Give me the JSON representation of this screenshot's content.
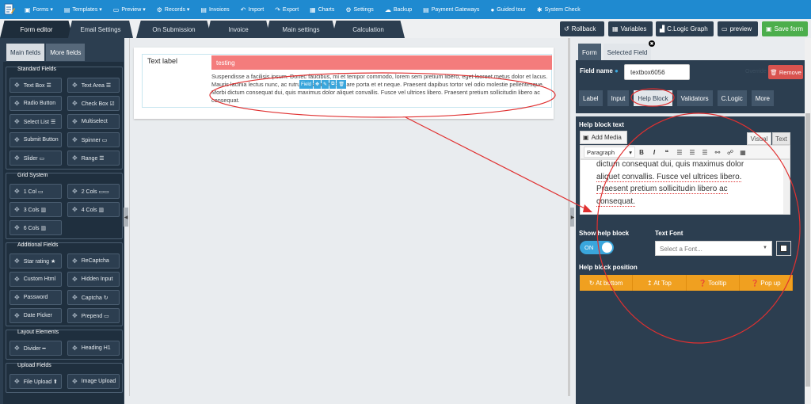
{
  "topnav": {
    "items": [
      {
        "icon": "▣",
        "label": "Forms ▾"
      },
      {
        "icon": "▤",
        "label": "Templates ▾"
      },
      {
        "icon": "▭",
        "label": "Preview ▾"
      },
      {
        "icon": "⚙",
        "label": "Records ▾"
      },
      {
        "icon": "▤",
        "label": "Invoices"
      },
      {
        "icon": "↶",
        "label": "Import"
      },
      {
        "icon": "↷",
        "label": "Export"
      },
      {
        "icon": "▦",
        "label": "Charts"
      },
      {
        "icon": "⚙",
        "label": "Settings"
      },
      {
        "icon": "☁",
        "label": "Backup"
      },
      {
        "icon": "▤",
        "label": "Payment Gateways"
      },
      {
        "icon": "●",
        "label": "Guided tour"
      },
      {
        "icon": "✱",
        "label": "System Check"
      }
    ]
  },
  "maintabs": [
    {
      "label": "Form editor"
    },
    {
      "label": "Email Settings"
    },
    {
      "label": "On Submission"
    },
    {
      "label": "Invoice"
    },
    {
      "label": "Main settings"
    },
    {
      "label": "Calculation"
    }
  ],
  "actions": [
    {
      "icon": "↺",
      "label": "Rollback"
    },
    {
      "icon": "▦",
      "label": "Variables"
    },
    {
      "icon": "▟",
      "label": "C.Logic Graph"
    },
    {
      "icon": "▭",
      "label": "preview"
    },
    {
      "icon": "▣",
      "label": "Save form"
    }
  ],
  "left": {
    "tabs": [
      "Main fields",
      "More fields"
    ],
    "groups": [
      {
        "title": "Standard Fields",
        "fields": [
          "Text Box ☰",
          "Text Area ☰",
          "Radio Button",
          "Check Box ☑",
          "Select List ☰",
          "Multiselect",
          "Submit Button",
          "Spinner ▭",
          "Slider ▭",
          "Range ☰"
        ]
      },
      {
        "title": "Grid System",
        "fields": [
          "1 Col ▭",
          "2 Cols ▭▭",
          "3 Cols ▥",
          "4 Cols ▥",
          "6 Cols ▥"
        ]
      },
      {
        "title": "Additional Fields",
        "fields": [
          "Star rating ★",
          "ReCaptcha",
          "Custom Html",
          "Hidden Input",
          "Password",
          "Captcha ↻",
          "Date Picker",
          "Prepend ▭"
        ]
      },
      {
        "title": "Layout Elements",
        "fields": [
          "Divider ━",
          "Heading H1"
        ]
      },
      {
        "title": "Upload Fields",
        "fields": [
          "File Upload ⬆",
          "Image Upload"
        ]
      }
    ]
  },
  "canvas": {
    "label": "Text label",
    "input_value": "testing",
    "help_text": "Suspendisse a facilisis ipsum. Donec faucibus, mi et tempor commodo, lorem sem pretium libero, eget laoreet metus dolor et lacus. Mauris lacinia lectus nunc, ac rutrum vitae metus ornare porta et et neque. Praesent dapibus tortor vel odio molestie pellentesque. Morbi dictum consequat dui, quis maximus dolor aliquet convallis. Fusce vel ultrices libero. Praesent pretium sollicitudin libero ac consequat.",
    "toolbar": [
      "Field",
      "✥",
      "✎",
      "⧉",
      "🗑"
    ]
  },
  "right": {
    "tabs": [
      "Form",
      "Selected Field"
    ],
    "close": "✖",
    "field_name_label": "Field name",
    "field_name_value": "textbox6056",
    "override": "Override",
    "remove": "🗑 Remove",
    "subtabs": [
      "Label",
      "Input",
      "Help Block",
      "Validators",
      "C.Logic",
      "More"
    ],
    "help_block_text": "Help block text",
    "add_media": "Add Media",
    "visual": "Visual",
    "text": "Text",
    "paragraph": "Paragraph",
    "editor_lines": [
      "dictum consequat dui, quis maximus dolor",
      "aliquet convallis. Fusce vel ultrices libero.",
      "Praesent pretium sollicitudin libero ac",
      "consequat."
    ],
    "show_help_block": "Show help block",
    "toggle": "ON",
    "text_font": "Text Font",
    "font_placeholder": "Select a Font...",
    "position_label": "Help block position",
    "positions": [
      "↻ At bottom",
      "↥ At Top",
      "❓ Tooltip",
      "❓ Pop up"
    ]
  }
}
